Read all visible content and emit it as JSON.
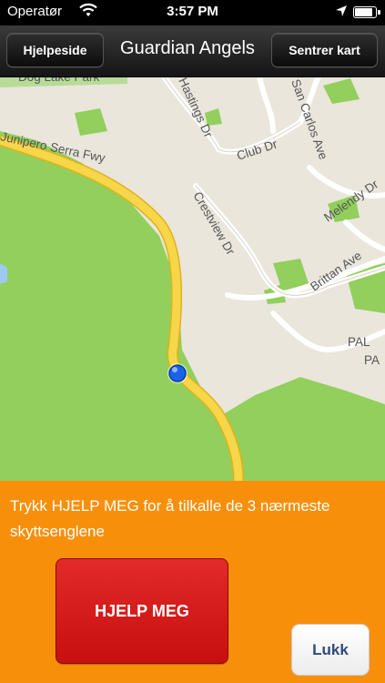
{
  "status_bar": {
    "carrier": "Operatør",
    "time": "3:57 PM",
    "icons": [
      "wifi-icon",
      "location-arrow-icon",
      "battery-icon"
    ]
  },
  "nav_bar": {
    "left_button": "Hjelpeside",
    "title": "Guardian Angels",
    "right_button": "Sentrer kart"
  },
  "map": {
    "labels": {
      "dog_lake_park": "Dog Lake Park",
      "hastings_dr": "Hastings Dr",
      "club_dr": "Club Dr",
      "carlos_ave": "San Carlos Ave",
      "freeway": "Junipero Serra Fwy",
      "crestview_dr": "Crestview Dr",
      "melendy": "Melendy Dr",
      "brittan_ave": "Brittan Ave",
      "pal": "PAL",
      "pa": "PA"
    },
    "colors": {
      "land": "#eae6dc",
      "park": "#92cf5c",
      "highway": "#f5d23a",
      "road": "#ffffff",
      "location_dot": "#1a63e8"
    }
  },
  "panel": {
    "message": "Trykk HJELP MEG for å tilkalle de 3 nærmeste skyttsenglene",
    "help_button": "HJELP MEG",
    "close_button": "Lukk",
    "colors": {
      "background": "#f88f0b",
      "help_button": "#d61b1b"
    }
  }
}
